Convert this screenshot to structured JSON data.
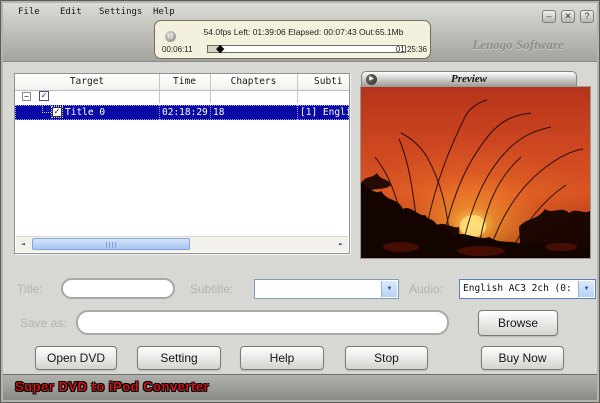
{
  "menu": {
    "items": [
      "File",
      "Edit",
      "Settings",
      "Help"
    ]
  },
  "titlebar": {
    "buttons": [
      "minimize",
      "close",
      "help"
    ]
  },
  "brand": {
    "watermark": "Lenogo Software"
  },
  "status": {
    "summary": "54.0fps Left: 01:39:06 Elapsed: 00:07:43 Out:65.1Mb",
    "time_start": "00:06:11",
    "time_end": "01:25:36",
    "progress_percent": 6
  },
  "dvd_table": {
    "columns": [
      "Target",
      "Time",
      "Chapters",
      "Subti"
    ],
    "rows": [
      {
        "target": "Title 0",
        "time": "02:18:29",
        "chapters": "18",
        "subtitle": "[1] Engli",
        "checked": true,
        "selected": true
      }
    ]
  },
  "preview": {
    "title": "Preview"
  },
  "fields": {
    "title_label": "Title:",
    "title_value": "",
    "subtitle_label": "Subtitle:",
    "subtitle_value": "",
    "audio_label": "Audio:",
    "audio_value": "English AC3 2ch (0:",
    "save_as_label": "Save as:",
    "save_as_value": "",
    "browse_label": "Browse"
  },
  "action_buttons": [
    {
      "label": "Open DVD"
    },
    {
      "label": "Setting"
    },
    {
      "label": "Help"
    },
    {
      "label": "Stop"
    },
    {
      "label": "Buy Now"
    }
  ],
  "footer": {
    "text": "Super DVD to iPod Converter"
  },
  "icons": {
    "minimize": "–",
    "close": "✕",
    "help": "?",
    "collapse": "−",
    "check": "✓",
    "dropdown_arrow": "▼",
    "scroll_left": "◄",
    "scroll_right": "►",
    "slider_marker": "◆",
    "play": "▶",
    "status_orb": "↺"
  },
  "colors": {
    "selection_blue": "#0a0aa6",
    "footer_red": "#d01414",
    "status_panel_bg": "#f3f1dd",
    "luna_border": "#7f9db9"
  }
}
